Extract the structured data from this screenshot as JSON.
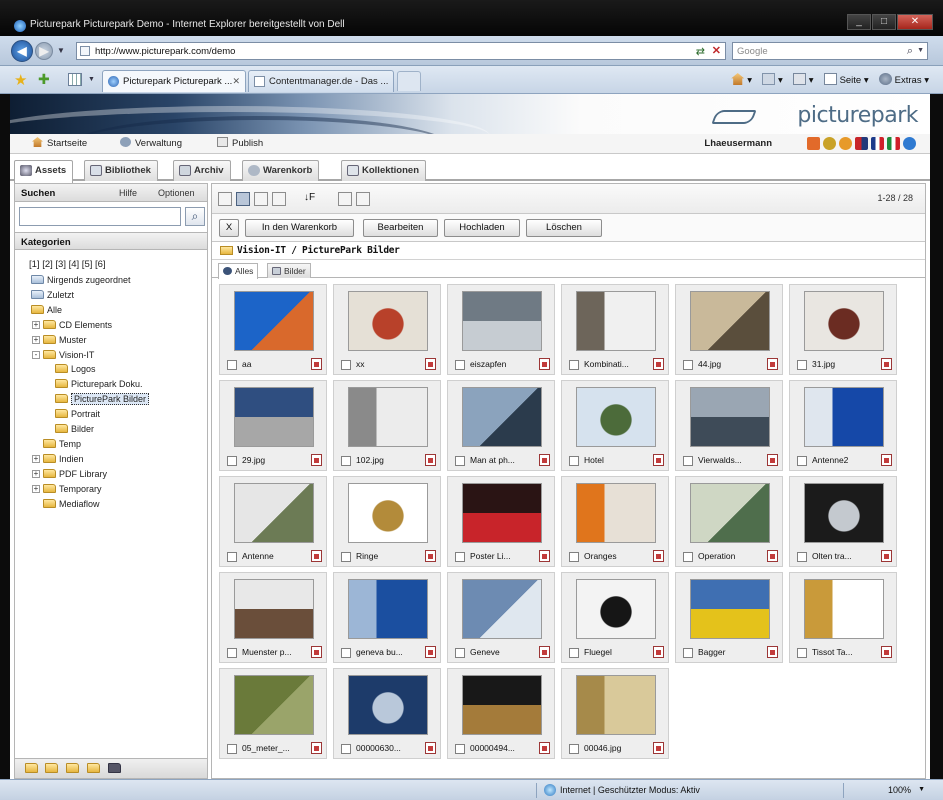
{
  "window": {
    "title": "Picturepark Picturepark Demo - Internet Explorer bereitgestellt von Dell",
    "controls": [
      "_",
      "□",
      "✕"
    ]
  },
  "addressbar": {
    "url": "http://www.picturepark.com/demo",
    "search_placeholder": "Google"
  },
  "browser_tabs": [
    {
      "label": "Picturepark Picturepark ...",
      "active": true
    },
    {
      "label": "Contentmanager.de - Das ...",
      "active": false
    }
  ],
  "command_bar": {
    "page_label": "Seite",
    "tools_label": "Extras"
  },
  "app": {
    "logo": "picturepark",
    "topnav": [
      {
        "label": "Startseite",
        "icon": "home-icon"
      },
      {
        "label": "Verwaltung",
        "icon": "admin-icon"
      },
      {
        "label": "Publish",
        "icon": "publish-icon"
      }
    ],
    "username": "Lhaeusermann",
    "tabs": [
      {
        "label": "Assets",
        "active": true
      },
      {
        "label": "Bibliothek",
        "active": false
      },
      {
        "label": "Archiv",
        "active": false
      },
      {
        "label": "Warenkorb",
        "active": false
      },
      {
        "label": "Kollektionen",
        "active": false
      }
    ]
  },
  "search_panel": {
    "title": "Suchen",
    "help_link": "Hilfe",
    "options_link": "Optionen",
    "input_value": "",
    "categories_title": "Kategorien",
    "pages": "[1] [2] [3] [4] [5] [6]"
  },
  "tree": [
    {
      "label": "Nirgends zugeordnet",
      "icon": "blue"
    },
    {
      "label": "Zuletzt",
      "icon": "blue"
    },
    {
      "label": "Alle",
      "icon": "folder"
    },
    {
      "label": "CD Elements",
      "icon": "folder",
      "expander": "+"
    },
    {
      "label": "Muster",
      "icon": "folder",
      "expander": "+"
    },
    {
      "label": "Vision-IT",
      "icon": "folder",
      "expander": "-"
    },
    {
      "label": "Logos",
      "icon": "folder"
    },
    {
      "label": "Picturepark Doku.",
      "icon": "folder"
    },
    {
      "label": "PicturePark Bilder",
      "icon": "folder",
      "selected": true
    },
    {
      "label": "Portrait",
      "icon": "folder"
    },
    {
      "label": "Bilder",
      "icon": "folder"
    },
    {
      "label": "Temp",
      "icon": "folder"
    },
    {
      "label": "Indien",
      "icon": "folder",
      "expander": "+"
    },
    {
      "label": "PDF Library",
      "icon": "folder",
      "expander": "+"
    },
    {
      "label": "Temporary",
      "icon": "folder",
      "expander": "+"
    },
    {
      "label": "Mediaflow",
      "icon": "folder"
    }
  ],
  "results": {
    "count": "1-28 / 28",
    "actions": {
      "close": "X",
      "cart": "In den Warenkorb",
      "edit": "Bearbeiten",
      "upload": "Hochladen",
      "delete": "Löschen"
    },
    "path": "Vision-IT / PicturePark Bilder",
    "subtabs": [
      {
        "label": "Alles",
        "active": true
      },
      {
        "label": "Bilder",
        "active": false
      }
    ],
    "assets": [
      {
        "name": "aa",
        "c1": "#1c64c8",
        "c2": "#d9692c"
      },
      {
        "name": "xx",
        "c1": "#e5e0d6",
        "c2": "#b8412a"
      },
      {
        "name": "eiszapfen",
        "c1": "#6f7a84",
        "c2": "#c6ccd2"
      },
      {
        "name": "Kombinati...",
        "c1": "#f0f0f0",
        "c2": "#6d655a"
      },
      {
        "name": "44.jpg",
        "c1": "#c9b99a",
        "c2": "#5a4e3c"
      },
      {
        "name": "31.jpg",
        "c1": "#e9e6e1",
        "c2": "#6b2c22"
      },
      {
        "name": "29.jpg",
        "c1": "#2f4e80",
        "c2": "#a7a7a7"
      },
      {
        "name": "102.jpg",
        "c1": "#ececec",
        "c2": "#8a8a8a"
      },
      {
        "name": "Man at ph...",
        "c1": "#8ba3bd",
        "c2": "#2b3b4c"
      },
      {
        "name": "Hotel",
        "c1": "#d6e2ee",
        "c2": "#4c6b3a"
      },
      {
        "name": "Vierwalds...",
        "c1": "#9aa6b3",
        "c2": "#3e4b58"
      },
      {
        "name": "Antenne2",
        "c1": "#1548a8",
        "c2": "#dfe6ee"
      },
      {
        "name": "Antenne",
        "c1": "#e6e6e6",
        "c2": "#6c7b55"
      },
      {
        "name": "Ringe",
        "c1": "#ffffff",
        "c2": "#b38b3a"
      },
      {
        "name": "Poster Li...",
        "c1": "#2a1414",
        "c2": "#c8242a"
      },
      {
        "name": "Oranges",
        "c1": "#e7e0d6",
        "c2": "#e0751c"
      },
      {
        "name": "Operation",
        "c1": "#cfd7c4",
        "c2": "#4f6e4c"
      },
      {
        "name": "Olten tra...",
        "c1": "#1b1b1b",
        "c2": "#c4c9cf"
      },
      {
        "name": "Muenster p...",
        "c1": "#e8e8e8",
        "c2": "#6a4e3a"
      },
      {
        "name": "geneva bu...",
        "c1": "#1b4fa0",
        "c2": "#9cb6d6"
      },
      {
        "name": "Geneve",
        "c1": "#6d8bb2",
        "c2": "#dfe7ef"
      },
      {
        "name": "Fluegel",
        "c1": "#f3f3f3",
        "c2": "#161616"
      },
      {
        "name": "Bagger",
        "c1": "#3f6fb2",
        "c2": "#e4c21b"
      },
      {
        "name": "Tissot Ta...",
        "c1": "#ffffff",
        "c2": "#c99a3a"
      },
      {
        "name": "05_meter_...",
        "c1": "#6a7a3a",
        "c2": "#9aa46a"
      },
      {
        "name": "00000630...",
        "c1": "#1d3b6a",
        "c2": "#b9c8da"
      },
      {
        "name": "00000494...",
        "c1": "#181818",
        "c2": "#a47b3a"
      },
      {
        "name": "00046.jpg",
        "c1": "#d9c99a",
        "c2": "#a68a4a"
      }
    ]
  },
  "statusbar": {
    "zone": "Internet | Geschützter Modus: Aktiv",
    "zoom": "100%"
  }
}
